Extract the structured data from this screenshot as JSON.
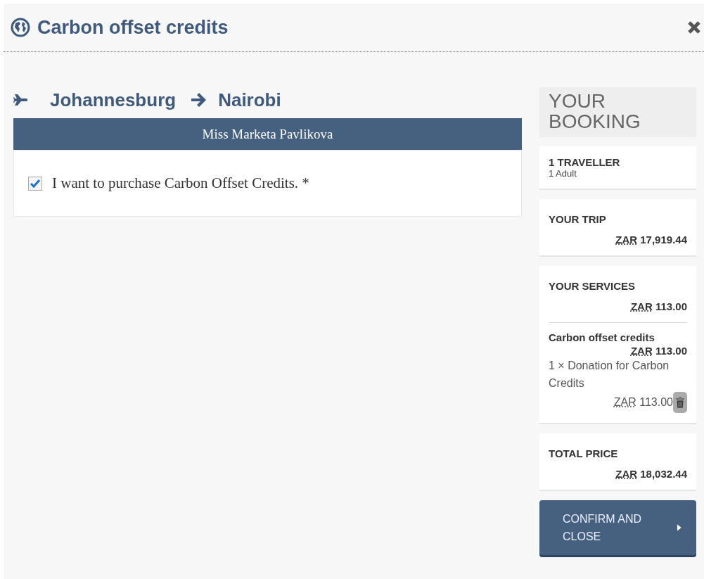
{
  "dialog": {
    "title": "Carbon offset credits"
  },
  "route": {
    "from": "Johannesburg",
    "to": "Nairobi"
  },
  "passenger": {
    "name": "Miss Marketa Pavlikova",
    "option": {
      "label": "I want to purchase Carbon Offset Credits. *",
      "checked": true
    }
  },
  "booking": {
    "title": "YOUR BOOKING",
    "travellers": {
      "heading": "1 TRAVELLER",
      "detail": "1 Adult"
    },
    "trip": {
      "heading": "YOUR TRIP",
      "currency": "ZAR",
      "amount": "17,919.44"
    },
    "services": {
      "heading": "YOUR SERVICES",
      "currency": "ZAR",
      "amount": "113.00",
      "items": [
        {
          "name": "Carbon offset credits",
          "currency": "ZAR",
          "amount": "113.00",
          "line": "1 × Donation for Carbon Credits",
          "line_currency": "ZAR",
          "line_amount": "113.00"
        }
      ]
    },
    "total": {
      "heading": "TOTAL PRICE",
      "currency": "ZAR",
      "amount": "18,032.44"
    },
    "confirm": "CONFIRM AND CLOSE"
  }
}
